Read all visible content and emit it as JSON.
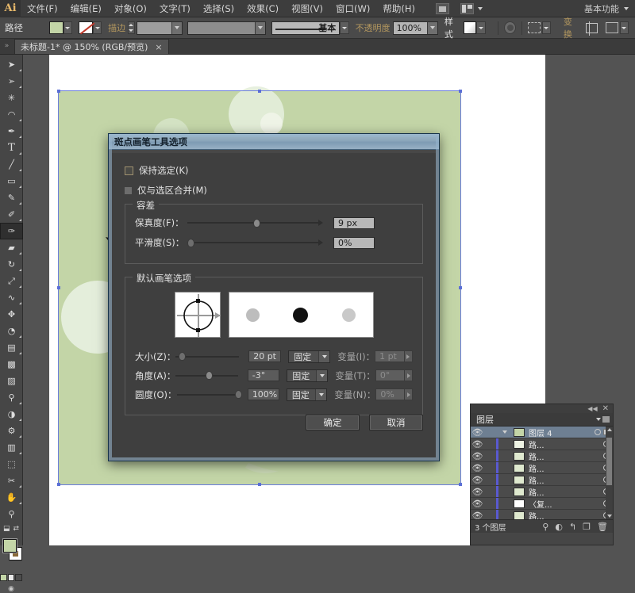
{
  "app": {
    "name": "Adobe Illustrator",
    "logo": "Ai"
  },
  "menubar": {
    "items": [
      {
        "label": "文件(F)"
      },
      {
        "label": "编辑(E)"
      },
      {
        "label": "对象(O)"
      },
      {
        "label": "文字(T)"
      },
      {
        "label": "选择(S)"
      },
      {
        "label": "效果(C)"
      },
      {
        "label": "视图(V)"
      },
      {
        "label": "窗口(W)"
      },
      {
        "label": "帮助(H)"
      }
    ],
    "bridge_icon": "bridge-icon",
    "arrange_icon": "arrange-documents-icon",
    "workspace": "基本功能"
  },
  "optionsbar": {
    "context_label": "路径",
    "fill_color": "#c3d5a7",
    "stroke_label": "描边",
    "stroke_weight": "",
    "stroke_profile": "",
    "brush_label": "基本",
    "opacity_label": "不透明度",
    "opacity_value": "100%",
    "style_label": "样式",
    "transparency_icon": "opacity-icon",
    "dashed_icon": "dashed-line-icon",
    "align_label": "变换",
    "align_icon": "align-icon",
    "more_icon": "more-options-icon"
  },
  "tab": {
    "title": "未标题-1* @ 150% (RGB/预览)",
    "close": "×"
  },
  "toolbar": {
    "tools": [
      {
        "name": "selection-tool",
        "glyph": "➤"
      },
      {
        "name": "direct-selection-tool",
        "glyph": "➤"
      },
      {
        "name": "magic-wand-tool",
        "glyph": "✳"
      },
      {
        "name": "lasso-tool",
        "glyph": "❀"
      },
      {
        "name": "pen-tool",
        "glyph": "✒"
      },
      {
        "name": "type-tool",
        "glyph": "T"
      },
      {
        "name": "line-segment-tool",
        "glyph": "╱"
      },
      {
        "name": "rectangle-tool",
        "glyph": "▭"
      },
      {
        "name": "paintbrush-tool",
        "glyph": "✐"
      },
      {
        "name": "pencil-tool",
        "glyph": "✎"
      },
      {
        "name": "blob-brush-tool",
        "glyph": "✒"
      },
      {
        "name": "eraser-tool",
        "glyph": "▰"
      },
      {
        "name": "rotate-tool",
        "glyph": "↻"
      },
      {
        "name": "scale-tool",
        "glyph": "⤡"
      },
      {
        "name": "width-tool",
        "glyph": "∿"
      },
      {
        "name": "free-transform-tool",
        "glyph": "✥"
      },
      {
        "name": "shape-builder-tool",
        "glyph": "◔"
      },
      {
        "name": "perspective-grid-tool",
        "glyph": "▦"
      },
      {
        "name": "mesh-tool",
        "glyph": "⌗"
      },
      {
        "name": "gradient-tool",
        "glyph": "▨"
      },
      {
        "name": "eyedropper-tool",
        "glyph": "✏"
      },
      {
        "name": "blend-tool",
        "glyph": "◑"
      },
      {
        "name": "symbol-sprayer-tool",
        "glyph": "⚘"
      },
      {
        "name": "column-graph-tool",
        "glyph": "▓"
      },
      {
        "name": "artboard-tool",
        "glyph": "⬚"
      },
      {
        "name": "slice-tool",
        "glyph": "✄"
      },
      {
        "name": "hand-tool",
        "glyph": "✋"
      },
      {
        "name": "zoom-tool",
        "glyph": "⚲"
      }
    ],
    "fill_color": "#c3d5a7",
    "stroke_color": "#ffffff"
  },
  "dialog": {
    "title": "斑点画笔工具选项",
    "checkboxes": [
      {
        "label": "保持选定(K)",
        "checked": false
      },
      {
        "label": "仅与选区合并(M)",
        "checked": false
      }
    ],
    "tolerance": {
      "legend": "容差",
      "rows": [
        {
          "label": "保真度(F)：",
          "value": "9 px",
          "slider_pct": 50
        },
        {
          "label": "平滑度(S)：",
          "value": "0%",
          "slider_pct": 0
        }
      ]
    },
    "brush_options": {
      "legend": "默认画笔选项",
      "angle_preview": "brush-angle-control",
      "dot_preview": "brush-dot-preview",
      "rows": [
        {
          "label": "大小(Z)：",
          "value": "20 pt",
          "slider_pct": 4,
          "mode": "固定",
          "var_label": "变量(I)：",
          "var_value": "1 pt",
          "disabled": true
        },
        {
          "label": "角度(A)：",
          "value": "-3°",
          "slider_pct": 48,
          "mode": "固定",
          "var_label": "变量(T)：",
          "var_value": "0°",
          "disabled": true
        },
        {
          "label": "圆度(O)：",
          "value": "100%",
          "slider_pct": 97,
          "mode": "固定",
          "var_label": "变量(N)：",
          "var_value": "0%",
          "disabled": true
        }
      ]
    },
    "buttons": [
      {
        "label": "确定",
        "name": "ok-button"
      },
      {
        "label": "取消",
        "name": "cancel-button"
      }
    ]
  },
  "layers_panel": {
    "title": "图层",
    "collapse_icon": "collapse-icon",
    "close_icon": "close-icon",
    "menu_icon": "panel-menu-icon",
    "rows": [
      {
        "name": "图层 4",
        "selected": true,
        "thumb": "#c3d5a7",
        "has_target_square": true
      },
      {
        "name": "路...",
        "selected": false,
        "thumb": "#eef3e4",
        "has_target_square": false
      },
      {
        "name": "路...",
        "selected": false,
        "thumb": "#dfe9cf",
        "has_target_square": false
      },
      {
        "name": "路...",
        "selected": false,
        "thumb": "#dfe9cf",
        "has_target_square": false
      },
      {
        "name": "路...",
        "selected": false,
        "thumb": "#dfe9cf",
        "has_target_square": false
      },
      {
        "name": "路...",
        "selected": false,
        "thumb": "#dfe9cf",
        "has_target_square": false
      },
      {
        "name": "〈复...",
        "selected": false,
        "thumb": "#ffffff",
        "has_target_square": false
      },
      {
        "name": "路...",
        "selected": false,
        "thumb": "#dfe9cf",
        "has_target_square": false
      }
    ],
    "count_label": "3 个图层",
    "tools": [
      {
        "name": "locate-object-icon",
        "glyph": "⚲"
      },
      {
        "name": "make-clipping-mask-icon",
        "glyph": "◐"
      },
      {
        "name": "create-new-sublayer-icon",
        "glyph": "↰"
      },
      {
        "name": "create-new-layer-icon",
        "glyph": "❐"
      },
      {
        "name": "delete-selection-icon",
        "glyph": "🗑"
      }
    ]
  },
  "artwork": {
    "artboard_color": "#c3d5a7",
    "page_color": "#ffffff"
  }
}
